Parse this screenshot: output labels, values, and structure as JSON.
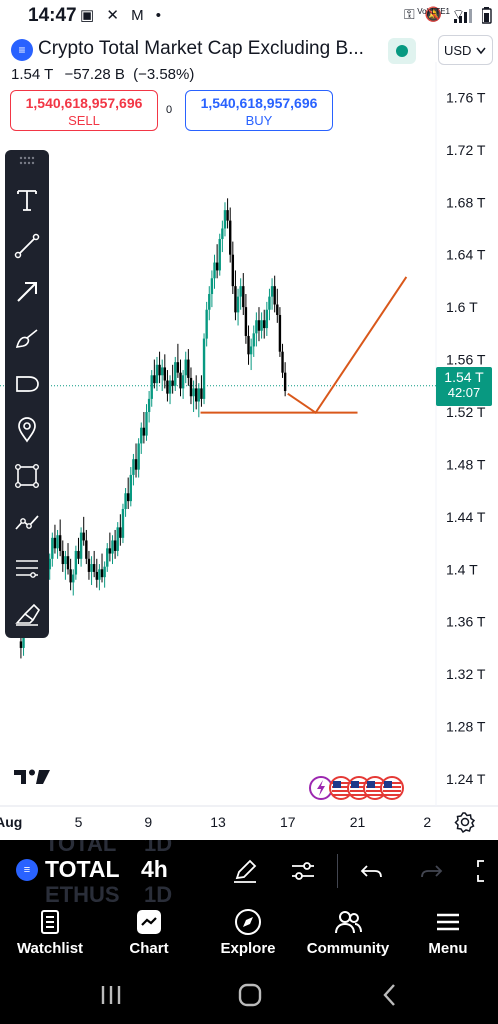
{
  "status_bar": {
    "time": "14:47",
    "left_icons": "▣ ✕ M •",
    "right_icons": "⚿ 🔕 ⌔",
    "lte": "Vo) LTE1",
    "battery_icon": "battery-icon"
  },
  "header": {
    "symbol_logo_text": "≡",
    "title": "Crypto Total Market Cap Excluding B...",
    "last_price": "1.54 T",
    "change_abs": "−57.28 B",
    "change_pct": "(−3.58%)",
    "currency": "USD"
  },
  "trade": {
    "sell_price": "1,540,618,957,696",
    "sell_label": "SELL",
    "spread": "0",
    "buy_price": "1,540,618,957,696",
    "buy_label": "BUY"
  },
  "colors": {
    "up": "#089981",
    "down": "#000000",
    "drawing": "#d9581b",
    "sell": "#f23645",
    "buy": "#2962ff",
    "background": "#ffffff",
    "toolbar": "#1e222d"
  },
  "price_tag": {
    "value": "1.54 T",
    "timer": "42:07"
  },
  "drawing_tools": [
    "text-tool-icon",
    "trend-line-icon",
    "arrow-tool-icon",
    "brush-icon",
    "shape-rect-rounded-icon",
    "pin-icon",
    "rectangle-icon",
    "path-icon",
    "parallel-lines-icon",
    "eraser-icon"
  ],
  "chart_data": {
    "type": "candlestick",
    "y_axis_labels": [
      "1.76 T",
      "1.72 T",
      "1.68 T",
      "1.64 T",
      "1.6 T",
      "1.56 T",
      "1.52 T",
      "1.48 T",
      "1.44 T",
      "1.4 T",
      "1.36 T",
      "1.32 T",
      "1.28 T",
      "1.24 T"
    ],
    "y_axis_values": [
      1.76,
      1.72,
      1.68,
      1.64,
      1.6,
      1.56,
      1.52,
      1.48,
      1.44,
      1.4,
      1.36,
      1.32,
      1.28,
      1.24
    ],
    "ylim": [
      1.224,
      1.787
    ],
    "x_axis_labels": [
      "Aug",
      "5",
      "9",
      "13",
      "17",
      "21",
      "2"
    ],
    "x_axis_days": [
      1,
      5,
      9,
      13,
      17,
      21,
      25
    ],
    "xlim": [
      0.5,
      25.5
    ],
    "interval": "4h",
    "last_price": 1.54,
    "candles": [
      {
        "d": 1.7,
        "o": 1.345,
        "h": 1.352,
        "l": 1.332,
        "c": 1.34
      },
      {
        "d": 1.85,
        "o": 1.34,
        "h": 1.358,
        "l": 1.334,
        "c": 1.355
      },
      {
        "d": 2.0,
        "o": 1.355,
        "h": 1.372,
        "l": 1.348,
        "c": 1.368
      },
      {
        "d": 2.15,
        "o": 1.368,
        "h": 1.38,
        "l": 1.36,
        "c": 1.365
      },
      {
        "d": 2.3,
        "o": 1.365,
        "h": 1.385,
        "l": 1.362,
        "c": 1.38
      },
      {
        "d": 2.45,
        "o": 1.38,
        "h": 1.392,
        "l": 1.37,
        "c": 1.375
      },
      {
        "d": 2.6,
        "o": 1.375,
        "h": 1.395,
        "l": 1.37,
        "c": 1.39
      },
      {
        "d": 2.75,
        "o": 1.39,
        "h": 1.4,
        "l": 1.378,
        "c": 1.382
      },
      {
        "d": 2.9,
        "o": 1.382,
        "h": 1.398,
        "l": 1.376,
        "c": 1.394
      },
      {
        "d": 3.05,
        "o": 1.394,
        "h": 1.412,
        "l": 1.388,
        "c": 1.405
      },
      {
        "d": 3.2,
        "o": 1.405,
        "h": 1.418,
        "l": 1.396,
        "c": 1.4
      },
      {
        "d": 3.35,
        "o": 1.4,
        "h": 1.412,
        "l": 1.392,
        "c": 1.408
      },
      {
        "d": 3.5,
        "o": 1.408,
        "h": 1.428,
        "l": 1.402,
        "c": 1.424
      },
      {
        "d": 3.65,
        "o": 1.424,
        "h": 1.434,
        "l": 1.412,
        "c": 1.416
      },
      {
        "d": 3.8,
        "o": 1.416,
        "h": 1.43,
        "l": 1.408,
        "c": 1.426
      },
      {
        "d": 3.95,
        "o": 1.426,
        "h": 1.438,
        "l": 1.41,
        "c": 1.414
      },
      {
        "d": 4.1,
        "o": 1.414,
        "h": 1.422,
        "l": 1.398,
        "c": 1.404
      },
      {
        "d": 4.25,
        "o": 1.404,
        "h": 1.414,
        "l": 1.392,
        "c": 1.41
      },
      {
        "d": 4.4,
        "o": 1.41,
        "h": 1.42,
        "l": 1.396,
        "c": 1.4
      },
      {
        "d": 4.55,
        "o": 1.4,
        "h": 1.408,
        "l": 1.384,
        "c": 1.39
      },
      {
        "d": 4.7,
        "o": 1.39,
        "h": 1.4,
        "l": 1.38,
        "c": 1.396
      },
      {
        "d": 4.85,
        "o": 1.396,
        "h": 1.418,
        "l": 1.392,
        "c": 1.414
      },
      {
        "d": 5.0,
        "o": 1.414,
        "h": 1.424,
        "l": 1.404,
        "c": 1.408
      },
      {
        "d": 5.15,
        "o": 1.408,
        "h": 1.432,
        "l": 1.402,
        "c": 1.428
      },
      {
        "d": 5.3,
        "o": 1.428,
        "h": 1.44,
        "l": 1.418,
        "c": 1.422
      },
      {
        "d": 5.45,
        "o": 1.422,
        "h": 1.43,
        "l": 1.404,
        "c": 1.408
      },
      {
        "d": 5.6,
        "o": 1.408,
        "h": 1.414,
        "l": 1.392,
        "c": 1.398
      },
      {
        "d": 5.75,
        "o": 1.398,
        "h": 1.41,
        "l": 1.388,
        "c": 1.404
      },
      {
        "d": 5.9,
        "o": 1.404,
        "h": 1.414,
        "l": 1.394,
        "c": 1.398
      },
      {
        "d": 6.05,
        "o": 1.398,
        "h": 1.408,
        "l": 1.386,
        "c": 1.392
      },
      {
        "d": 6.2,
        "o": 1.392,
        "h": 1.404,
        "l": 1.384,
        "c": 1.4
      },
      {
        "d": 6.35,
        "o": 1.4,
        "h": 1.412,
        "l": 1.39,
        "c": 1.394
      },
      {
        "d": 6.5,
        "o": 1.394,
        "h": 1.406,
        "l": 1.386,
        "c": 1.402
      },
      {
        "d": 6.65,
        "o": 1.402,
        "h": 1.42,
        "l": 1.398,
        "c": 1.416
      },
      {
        "d": 6.8,
        "o": 1.416,
        "h": 1.428,
        "l": 1.406,
        "c": 1.412
      },
      {
        "d": 6.95,
        "o": 1.412,
        "h": 1.426,
        "l": 1.404,
        "c": 1.422
      },
      {
        "d": 7.1,
        "o": 1.422,
        "h": 1.43,
        "l": 1.408,
        "c": 1.414
      },
      {
        "d": 7.25,
        "o": 1.414,
        "h": 1.436,
        "l": 1.41,
        "c": 1.432
      },
      {
        "d": 7.4,
        "o": 1.432,
        "h": 1.442,
        "l": 1.418,
        "c": 1.424
      },
      {
        "d": 7.55,
        "o": 1.424,
        "h": 1.45,
        "l": 1.42,
        "c": 1.446
      },
      {
        "d": 7.7,
        "o": 1.446,
        "h": 1.462,
        "l": 1.44,
        "c": 1.458
      },
      {
        "d": 7.85,
        "o": 1.458,
        "h": 1.47,
        "l": 1.446,
        "c": 1.452
      },
      {
        "d": 8.0,
        "o": 1.452,
        "h": 1.478,
        "l": 1.448,
        "c": 1.472
      },
      {
        "d": 8.15,
        "o": 1.472,
        "h": 1.488,
        "l": 1.464,
        "c": 1.484
      },
      {
        "d": 8.3,
        "o": 1.484,
        "h": 1.496,
        "l": 1.47,
        "c": 1.476
      },
      {
        "d": 8.45,
        "o": 1.476,
        "h": 1.5,
        "l": 1.47,
        "c": 1.496
      },
      {
        "d": 8.6,
        "o": 1.496,
        "h": 1.512,
        "l": 1.488,
        "c": 1.508
      },
      {
        "d": 8.75,
        "o": 1.508,
        "h": 1.52,
        "l": 1.496,
        "c": 1.502
      },
      {
        "d": 8.9,
        "o": 1.502,
        "h": 1.526,
        "l": 1.498,
        "c": 1.52
      },
      {
        "d": 9.05,
        "o": 1.52,
        "h": 1.536,
        "l": 1.512,
        "c": 1.53
      },
      {
        "d": 9.2,
        "o": 1.53,
        "h": 1.552,
        "l": 1.524,
        "c": 1.548
      },
      {
        "d": 9.35,
        "o": 1.548,
        "h": 1.56,
        "l": 1.538,
        "c": 1.542
      },
      {
        "d": 9.5,
        "o": 1.542,
        "h": 1.562,
        "l": 1.536,
        "c": 1.556
      },
      {
        "d": 9.65,
        "o": 1.556,
        "h": 1.566,
        "l": 1.542,
        "c": 1.548
      },
      {
        "d": 9.8,
        "o": 1.548,
        "h": 1.56,
        "l": 1.536,
        "c": 1.554
      },
      {
        "d": 9.95,
        "o": 1.554,
        "h": 1.564,
        "l": 1.538,
        "c": 1.544
      },
      {
        "d": 10.1,
        "o": 1.544,
        "h": 1.552,
        "l": 1.528,
        "c": 1.534
      },
      {
        "d": 10.25,
        "o": 1.534,
        "h": 1.548,
        "l": 1.526,
        "c": 1.544
      },
      {
        "d": 10.4,
        "o": 1.544,
        "h": 1.556,
        "l": 1.534,
        "c": 1.54
      },
      {
        "d": 10.55,
        "o": 1.54,
        "h": 1.562,
        "l": 1.536,
        "c": 1.558
      },
      {
        "d": 10.7,
        "o": 1.558,
        "h": 1.572,
        "l": 1.546,
        "c": 1.55
      },
      {
        "d": 10.85,
        "o": 1.55,
        "h": 1.56,
        "l": 1.532,
        "c": 1.538
      },
      {
        "d": 11.0,
        "o": 1.538,
        "h": 1.552,
        "l": 1.53,
        "c": 1.548
      },
      {
        "d": 11.15,
        "o": 1.548,
        "h": 1.566,
        "l": 1.542,
        "c": 1.56
      },
      {
        "d": 11.3,
        "o": 1.56,
        "h": 1.568,
        "l": 1.54,
        "c": 1.546
      },
      {
        "d": 11.45,
        "o": 1.546,
        "h": 1.554,
        "l": 1.526,
        "c": 1.532
      },
      {
        "d": 11.6,
        "o": 1.532,
        "h": 1.544,
        "l": 1.52,
        "c": 1.538
      },
      {
        "d": 11.75,
        "o": 1.538,
        "h": 1.548,
        "l": 1.522,
        "c": 1.528
      },
      {
        "d": 11.9,
        "o": 1.528,
        "h": 1.542,
        "l": 1.516,
        "c": 1.538
      },
      {
        "d": 12.05,
        "o": 1.538,
        "h": 1.548,
        "l": 1.524,
        "c": 1.53
      },
      {
        "d": 12.2,
        "o": 1.53,
        "h": 1.58,
        "l": 1.526,
        "c": 1.576
      },
      {
        "d": 12.35,
        "o": 1.576,
        "h": 1.604,
        "l": 1.57,
        "c": 1.598
      },
      {
        "d": 12.5,
        "o": 1.598,
        "h": 1.616,
        "l": 1.59,
        "c": 1.61
      },
      {
        "d": 12.65,
        "o": 1.61,
        "h": 1.628,
        "l": 1.6,
        "c": 1.622
      },
      {
        "d": 12.8,
        "o": 1.622,
        "h": 1.64,
        "l": 1.614,
        "c": 1.634
      },
      {
        "d": 12.95,
        "o": 1.634,
        "h": 1.648,
        "l": 1.622,
        "c": 1.628
      },
      {
        "d": 13.1,
        "o": 1.628,
        "h": 1.656,
        "l": 1.624,
        "c": 1.652
      },
      {
        "d": 13.25,
        "o": 1.652,
        "h": 1.666,
        "l": 1.642,
        "c": 1.66
      },
      {
        "d": 13.4,
        "o": 1.66,
        "h": 1.68,
        "l": 1.654,
        "c": 1.674
      },
      {
        "d": 13.55,
        "o": 1.674,
        "h": 1.683,
        "l": 1.66,
        "c": 1.666
      },
      {
        "d": 13.7,
        "o": 1.666,
        "h": 1.676,
        "l": 1.634,
        "c": 1.64
      },
      {
        "d": 13.85,
        "o": 1.64,
        "h": 1.65,
        "l": 1.61,
        "c": 1.616
      },
      {
        "d": 14.0,
        "o": 1.616,
        "h": 1.628,
        "l": 1.59,
        "c": 1.596
      },
      {
        "d": 14.15,
        "o": 1.596,
        "h": 1.614,
        "l": 1.586,
        "c": 1.608
      },
      {
        "d": 14.3,
        "o": 1.608,
        "h": 1.622,
        "l": 1.598,
        "c": 1.616
      },
      {
        "d": 14.45,
        "o": 1.616,
        "h": 1.626,
        "l": 1.594,
        "c": 1.6
      },
      {
        "d": 14.6,
        "o": 1.6,
        "h": 1.61,
        "l": 1.572,
        "c": 1.578
      },
      {
        "d": 14.75,
        "o": 1.578,
        "h": 1.586,
        "l": 1.556,
        "c": 1.564
      },
      {
        "d": 14.9,
        "o": 1.564,
        "h": 1.576,
        "l": 1.552,
        "c": 1.57
      },
      {
        "d": 15.05,
        "o": 1.57,
        "h": 1.586,
        "l": 1.562,
        "c": 1.58
      },
      {
        "d": 15.2,
        "o": 1.58,
        "h": 1.596,
        "l": 1.57,
        "c": 1.59
      },
      {
        "d": 15.35,
        "o": 1.59,
        "h": 1.6,
        "l": 1.574,
        "c": 1.582
      },
      {
        "d": 15.5,
        "o": 1.582,
        "h": 1.596,
        "l": 1.576,
        "c": 1.59
      },
      {
        "d": 15.65,
        "o": 1.59,
        "h": 1.598,
        "l": 1.576,
        "c": 1.584
      },
      {
        "d": 15.8,
        "o": 1.584,
        "h": 1.604,
        "l": 1.578,
        "c": 1.598
      },
      {
        "d": 15.95,
        "o": 1.598,
        "h": 1.614,
        "l": 1.59,
        "c": 1.608
      },
      {
        "d": 16.1,
        "o": 1.608,
        "h": 1.622,
        "l": 1.598,
        "c": 1.616
      },
      {
        "d": 16.25,
        "o": 1.616,
        "h": 1.624,
        "l": 1.596,
        "c": 1.602
      },
      {
        "d": 16.4,
        "o": 1.602,
        "h": 1.614,
        "l": 1.588,
        "c": 1.594
      },
      {
        "d": 16.55,
        "o": 1.594,
        "h": 1.6,
        "l": 1.562,
        "c": 1.566
      },
      {
        "d": 16.7,
        "o": 1.566,
        "h": 1.572,
        "l": 1.546,
        "c": 1.55
      },
      {
        "d": 16.85,
        "o": 1.55,
        "h": 1.558,
        "l": 1.532,
        "c": 1.536
      }
    ],
    "annotations": {
      "horizontal_line": {
        "price": 1.5195,
        "from_day": 12.0,
        "to_day": 21.0
      },
      "projection_path": [
        {
          "day": 17.0,
          "price": 1.534
        },
        {
          "day": 18.6,
          "price": 1.5195
        },
        {
          "day": 23.8,
          "price": 1.623
        }
      ]
    },
    "grid": false
  },
  "bottom_toolbar": {
    "logo_text": "≡",
    "symbol": "TOTAL",
    "interval": "4h",
    "ghost_above_symbol": "TOTAL",
    "ghost_above_interval": "1D",
    "ghost_below_symbol": "ETHUS",
    "ghost_below_interval": "1D"
  },
  "nav": {
    "watchlist": "Watchlist",
    "chart": "Chart",
    "explore": "Explore",
    "community": "Community",
    "menu": "Menu"
  }
}
